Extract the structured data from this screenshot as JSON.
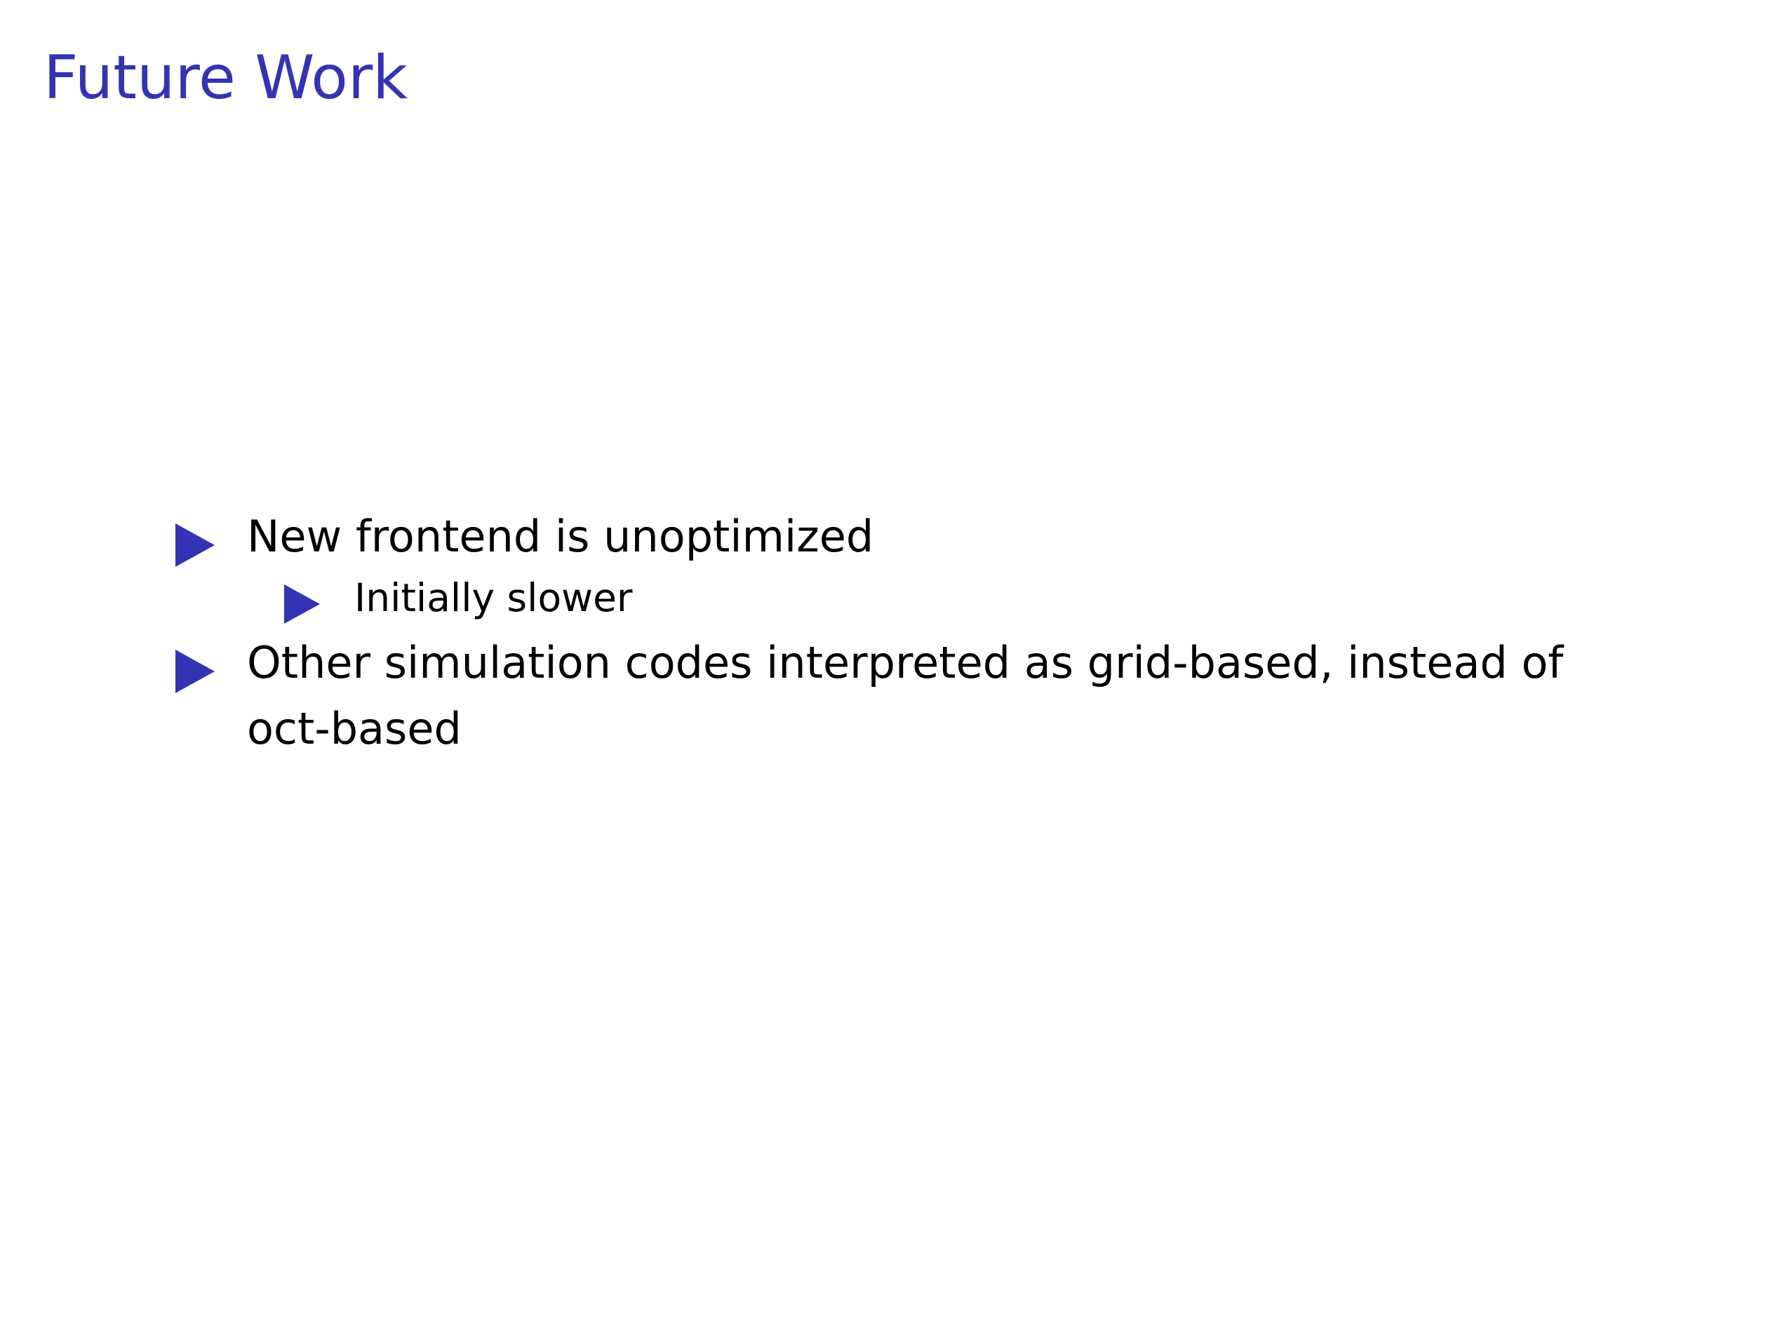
{
  "slide": {
    "title": "Future Work",
    "accent_color": "#3333b3",
    "bullet_icon": "blue-triangle-bullet",
    "items": [
      {
        "text": "New frontend is unoptimized",
        "subitems": [
          {
            "text": "Initially slower"
          }
        ]
      },
      {
        "text": "Other simulation codes interpreted as grid-based, instead of oct-based",
        "subitems": []
      }
    ]
  }
}
